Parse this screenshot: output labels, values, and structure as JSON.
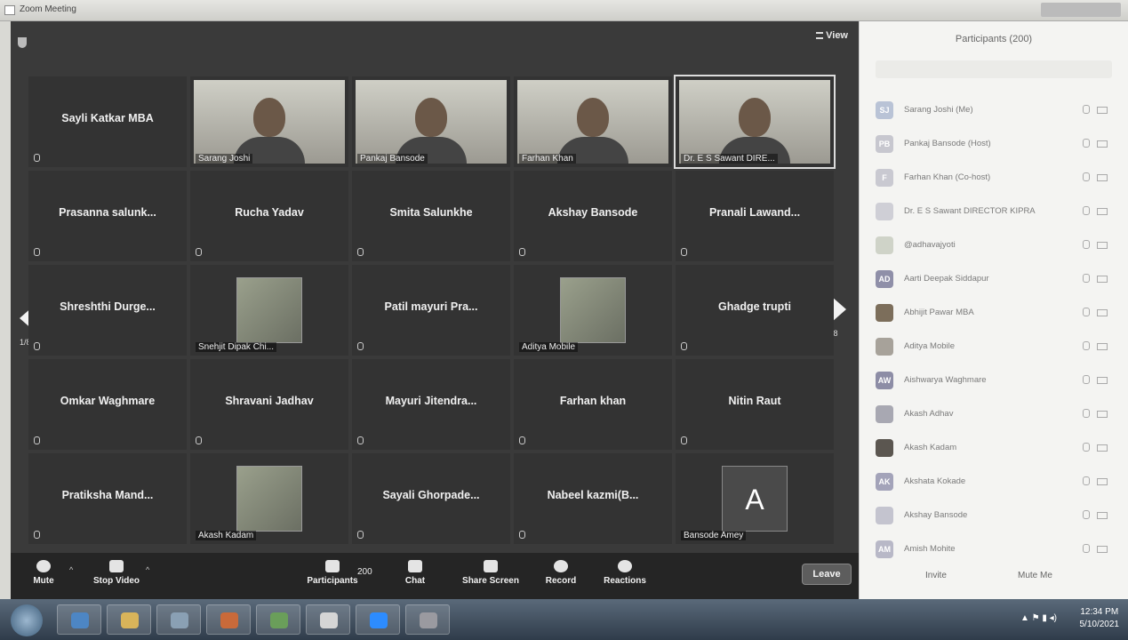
{
  "window": {
    "title": "Zoom Meeting"
  },
  "meeting": {
    "view_label": "View",
    "page_left": "1/8",
    "page_right": "1/8",
    "tiles": [
      {
        "name": "Sayli Katkar MBA",
        "kind": "name"
      },
      {
        "name": "Sarang Joshi",
        "kind": "video"
      },
      {
        "name": "Pankaj Bansode",
        "kind": "video"
      },
      {
        "name": "Farhan Khan",
        "kind": "video"
      },
      {
        "name": "Dr. E S Sawant DIRE...",
        "kind": "video",
        "active": true
      },
      {
        "name": "Prasanna salunk...",
        "kind": "name"
      },
      {
        "name": "Rucha Yadav",
        "kind": "name"
      },
      {
        "name": "Smita Salunkhe",
        "kind": "name"
      },
      {
        "name": "Akshay Bansode",
        "kind": "name"
      },
      {
        "name": "Pranali Lawand...",
        "kind": "name"
      },
      {
        "name": "Shreshthi Durge...",
        "kind": "name"
      },
      {
        "name": "Snehjit Dipak Chi...",
        "kind": "picture"
      },
      {
        "name": "Patil mayuri Pra...",
        "kind": "name"
      },
      {
        "name": "Aditya Mobile",
        "kind": "picture"
      },
      {
        "name": "Ghadge trupti",
        "kind": "name"
      },
      {
        "name": "Omkar Waghmare",
        "kind": "name"
      },
      {
        "name": "Shravani Jadhav",
        "kind": "name"
      },
      {
        "name": "Mayuri Jitendra...",
        "kind": "name"
      },
      {
        "name": "Farhan khan",
        "kind": "name"
      },
      {
        "name": "Nitin Raut",
        "kind": "name"
      },
      {
        "name": "Pratiksha Mand...",
        "kind": "name"
      },
      {
        "name": "Akash Kadam",
        "kind": "picture"
      },
      {
        "name": "Sayali Ghorpade...",
        "kind": "name"
      },
      {
        "name": "Nabeel kazmi(B...",
        "kind": "name"
      },
      {
        "name": "Bansode Amey",
        "kind": "avatar",
        "letter": "A"
      }
    ]
  },
  "toolbar": {
    "mute": "Mute",
    "stop_video": "Stop Video",
    "participants": "Participants",
    "participants_count": "200",
    "chat": "Chat",
    "share_screen": "Share Screen",
    "record": "Record",
    "reactions": "Reactions",
    "leave": "Leave"
  },
  "panel": {
    "title": "Participants (200)",
    "participants": [
      {
        "initials": "SJ",
        "name": "Sarang Joshi (Me)",
        "avatar_color": "#b9c3d6"
      },
      {
        "initials": "PB",
        "name": "Pankaj Bansode (Host)",
        "avatar_color": "#c7c7cf"
      },
      {
        "initials": "F",
        "name": "Farhan Khan (Co-host)",
        "avatar_color": "#c9c9d1"
      },
      {
        "initials": "",
        "name": "Dr. E S Sawant DIRECTOR KIPRA",
        "avatar_color": "#cfcfd6"
      },
      {
        "initials": "",
        "name": "@adhavajyoti",
        "avatar_color": "#cfd3c8"
      },
      {
        "initials": "AD",
        "name": "Aarti Deepak Siddapur",
        "avatar_color": "#8f8fa8"
      },
      {
        "initials": "",
        "name": "Abhijit Pawar MBA",
        "avatar_color": "#7c6e5b"
      },
      {
        "initials": "",
        "name": "Aditya Mobile",
        "avatar_color": "#a7a29a"
      },
      {
        "initials": "AW",
        "name": "Aishwarya Waghmare",
        "avatar_color": "#8d8da6"
      },
      {
        "initials": "",
        "name": "Akash Adhav",
        "avatar_color": "#a8a8b2"
      },
      {
        "initials": "",
        "name": "Akash Kadam",
        "avatar_color": "#5b5650"
      },
      {
        "initials": "AK",
        "name": "Akshata Kokade",
        "avatar_color": "#a3a3b9"
      },
      {
        "initials": "",
        "name": "Akshay Bansode",
        "avatar_color": "#c4c4cf"
      },
      {
        "initials": "AM",
        "name": "Amish Mohite",
        "avatar_color": "#b8b8c7"
      }
    ],
    "invite": "Invite",
    "mute_me": "Mute Me"
  },
  "taskbar": {
    "time": "12:34 PM",
    "date": "5/10/2021"
  }
}
